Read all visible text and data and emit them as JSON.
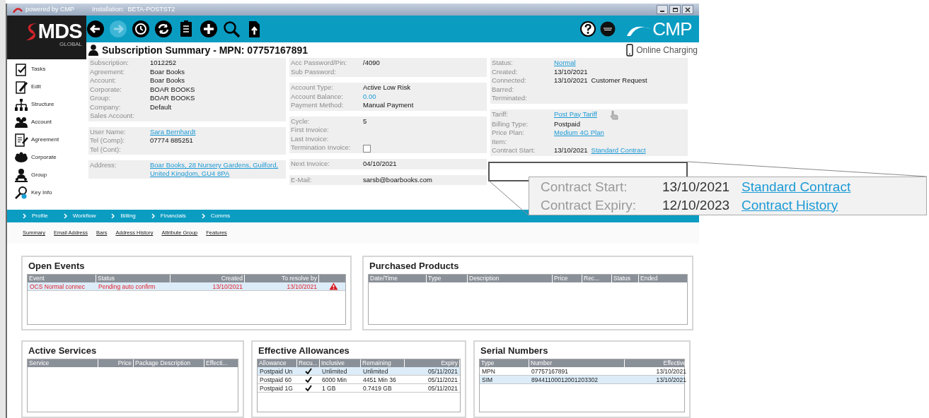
{
  "title_bar": {
    "brand": "powered by CMP",
    "installation": "Installation:  BETA-POSTST2"
  },
  "logo": {
    "text": "MDS",
    "sub": "GLOBAL"
  },
  "toolbar": {
    "buttons": [
      {
        "disabled": false
      },
      {
        "disabled": true
      },
      {
        "disabled": false
      },
      {
        "disabled": false
      },
      {
        "disabled": false
      },
      {
        "disabled": false
      },
      {
        "disabled": false
      },
      {
        "disabled": false
      }
    ],
    "brand": "CMP"
  },
  "header": {
    "title": "Subscription Summary - MPN: 07757167891",
    "mode": "Online Charging"
  },
  "sidebar": {
    "items": [
      {
        "label": "Tasks"
      },
      {
        "label": "Edit"
      },
      {
        "label": "Structure"
      },
      {
        "label": "Account"
      },
      {
        "label": "Agreement"
      },
      {
        "label": "Corporate"
      },
      {
        "label": "Group"
      },
      {
        "label": "Key Info"
      }
    ]
  },
  "columns": [
    {
      "groups": [
        {
          "fields": [
            {
              "label": "Subscription:",
              "value": "1012252"
            },
            {
              "label": "Agreement:",
              "value": "Boar Books"
            },
            {
              "label": "Account:",
              "value": "Boar Books"
            },
            {
              "label": "Corporate:",
              "value": "BOAR BOOKS"
            },
            {
              "label": "Group:",
              "value": "BOAR BOOKS"
            },
            {
              "label": "Company:",
              "value": "Default"
            },
            {
              "label": "Sales Account:"
            }
          ]
        },
        {
          "fields": [
            {
              "label": "User Name:",
              "value": "Sara Bernhardt",
              "kind": "link"
            },
            {
              "label": "Tel (Comp):",
              "value": "07774 885251"
            },
            {
              "label": "Tel (Cont):"
            }
          ]
        },
        {
          "fields": [
            {
              "label": "Address:",
              "value": "Boar Books, 28 Nursery Gardens, Guilford, United Kingdom, GU4 8PA",
              "kind": "link"
            }
          ]
        }
      ]
    },
    {
      "groups": [
        {
          "fields": [
            {
              "label": "Acc Password/Pin:",
              "value": "/4090"
            },
            {
              "label": "Sub Password:"
            }
          ]
        },
        {
          "fields": [
            {
              "label": "Account Type:",
              "value": "Active Low Risk"
            },
            {
              "label": "Account Balance:",
              "value": "0.00",
              "kind": "amount"
            },
            {
              "label": "Payment Method:",
              "value": "Manual Payment"
            }
          ]
        },
        {
          "fields": [
            {
              "label": "Cycle:",
              "value": "5"
            },
            {
              "label": "First Invoice:"
            },
            {
              "label": "Last Invoice:"
            },
            {
              "label": "Termination Invoice:",
              "kind": "checkbox",
              "checked": false
            }
          ]
        },
        {
          "fields": [
            {
              "label": "Next Invoice:",
              "value": "04/10/2021"
            }
          ]
        },
        {
          "fields": [
            {
              "label": "E-Mail:",
              "value": "sarsb@boarbooks.com"
            }
          ]
        }
      ]
    },
    {
      "groups": [
        {
          "fields": [
            {
              "label": "Status:",
              "value": "Normal",
              "kind": "link"
            },
            {
              "label": "Created:",
              "value": "13/10/2021"
            },
            {
              "label": "Connected:",
              "value": "13/10/2021",
              "extra": "Customer Request"
            },
            {
              "label": "Barred:"
            },
            {
              "label": "Terminated:"
            }
          ]
        },
        {
          "fields": [
            {
              "label": "Tariff:",
              "value": "Post Pay Tariff",
              "kind": "link",
              "pointer": true
            },
            {
              "label": "Billing Type:",
              "value": "Postpaid"
            },
            {
              "label": "Price Plan:",
              "value": "Medium 4G Plan",
              "kind": "link"
            },
            {
              "label": "Item:"
            },
            {
              "label": "Contract Start:",
              "value": "13/10/2021",
              "extra_link": "Standard Contract"
            }
          ]
        }
      ]
    }
  ],
  "nav": [
    {
      "label": "Profile"
    },
    {
      "label": "Workflow"
    },
    {
      "label": "Billing"
    },
    {
      "label": "Financials"
    },
    {
      "label": "Comms"
    }
  ],
  "subtabs": [
    {
      "label": "Summary"
    },
    {
      "label": "Email Address"
    },
    {
      "label": "Bars"
    },
    {
      "label": "Address History"
    },
    {
      "label": "Attribute Group"
    },
    {
      "label": "Features"
    }
  ],
  "panels": [
    {
      "title": "Open Events",
      "columns": [
        {
          "label": "Event"
        },
        {
          "label": "Status"
        },
        {
          "label": "Created",
          "right_aligned": true
        },
        {
          "label": "To resolve by",
          "right_aligned": true
        }
      ],
      "rows": [
        {
          "cells": [
            "OCS Normal connec",
            "Pending auto confirm",
            "13/10/2021",
            "13/10/2021"
          ],
          "alert": true,
          "selected": true
        }
      ]
    },
    {
      "title": "Purchased Products",
      "columns": [
        {
          "label": "Date/Time"
        },
        {
          "label": "Type"
        },
        {
          "label": "Description"
        },
        {
          "label": "Price"
        },
        {
          "label": "Rec..."
        },
        {
          "label": "Status"
        },
        {
          "label": "Ended"
        }
      ]
    },
    {
      "title": "Active Services",
      "columns": [
        {
          "label": "Service"
        },
        {
          "label": "Price",
          "right_aligned": true
        },
        {
          "label": "Package Description"
        },
        {
          "label": "Effecti..."
        }
      ]
    },
    {
      "title": "Effective Allowances",
      "columns": [
        {
          "label": "Allowance"
        },
        {
          "label": "Recu..."
        },
        {
          "label": "Inclusive"
        },
        {
          "label": "Remaining"
        },
        {
          "label": "Expiry",
          "right_aligned": true
        }
      ],
      "rows": [
        {
          "cells": [
            "Postpaid Un",
            true,
            "Unlimited",
            "Unlimited",
            "05/11/2021"
          ],
          "selected": true
        },
        {
          "cells": [
            "Postpaid 60",
            true,
            "6000 Min",
            "4451 Min 36",
            "05/11/2021"
          ],
          "selected": false
        },
        {
          "cells": [
            "Postpaid 1G",
            true,
            "1 GB",
            "0.7419 GB",
            "05/11/2021"
          ],
          "selected": false
        }
      ]
    },
    {
      "title": "Serial Numbers",
      "columns": [
        {
          "label": "Type"
        },
        {
          "label": "Number"
        },
        {
          "label": "Effective",
          "right_aligned": true
        }
      ],
      "rows": [
        {
          "cells": [
            "MPN",
            "07757167891",
            "13/10/2021"
          ],
          "selected": false
        },
        {
          "cells": [
            "SIM",
            "89441100012001203302",
            "13/10/2021"
          ],
          "selected": true
        }
      ]
    }
  ],
  "callout": {
    "rows": [
      {
        "label": "Contract Start:",
        "value": "13/10/2021",
        "link": "Standard Contract"
      },
      {
        "label": "Contract Expiry:",
        "value": "12/10/2023",
        "link": "Contract History"
      }
    ]
  }
}
